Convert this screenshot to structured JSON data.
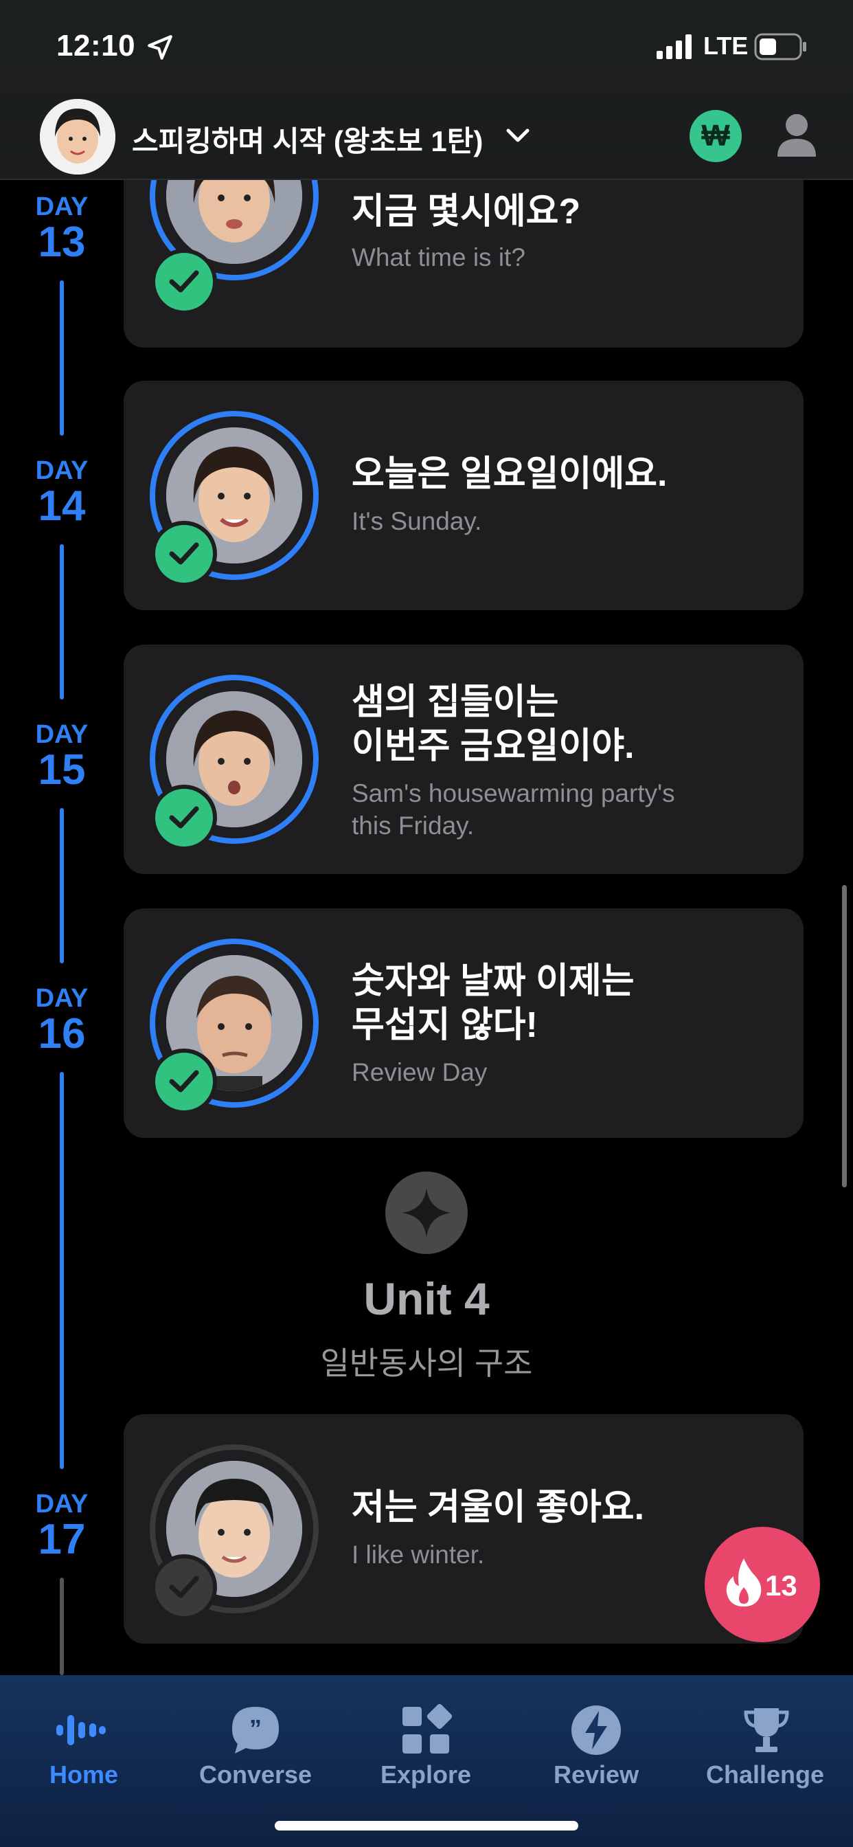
{
  "status_bar": {
    "time": "12:10",
    "network": "LTE"
  },
  "header": {
    "course_title": "스피킹하며 시작 (왕초보 1탄)",
    "currency_symbol": "₩"
  },
  "lessons": [
    {
      "day_word": "DAY",
      "day_num": "13",
      "title": "지금 몇시에요?",
      "subtitle": "What time is it?",
      "completed": true
    },
    {
      "day_word": "DAY",
      "day_num": "14",
      "title": "오늘은 일요일이에요.",
      "subtitle": "It's Sunday.",
      "completed": true
    },
    {
      "day_word": "DAY",
      "day_num": "15",
      "title_line1": "샘의 집들이는",
      "title_line2": "이번주 금요일이야.",
      "subtitle_line1": "Sam's housewarming party's",
      "subtitle_line2": "this Friday.",
      "completed": true
    },
    {
      "day_word": "DAY",
      "day_num": "16",
      "title_line1": "숫자와 날짜 이제는",
      "title_line2": "무섭지 않다!",
      "subtitle": "Review Day",
      "completed": true
    },
    {
      "day_word": "DAY",
      "day_num": "17",
      "title": "저는 겨울이 좋아요.",
      "subtitle": "I like winter.",
      "completed": false
    }
  ],
  "unit": {
    "title": "Unit 4",
    "subtitle": "일반동사의 구조"
  },
  "streak": {
    "count": "13"
  },
  "tabs": [
    {
      "label": "Home",
      "active": true
    },
    {
      "label": "Converse",
      "active": false
    },
    {
      "label": "Explore",
      "active": false
    },
    {
      "label": "Review",
      "active": false
    },
    {
      "label": "Challenge",
      "active": false
    }
  ],
  "colors": {
    "accent": "#2f7ff6",
    "success": "#31c27f",
    "streak": "#e8466a",
    "currency": "#35c58d"
  }
}
